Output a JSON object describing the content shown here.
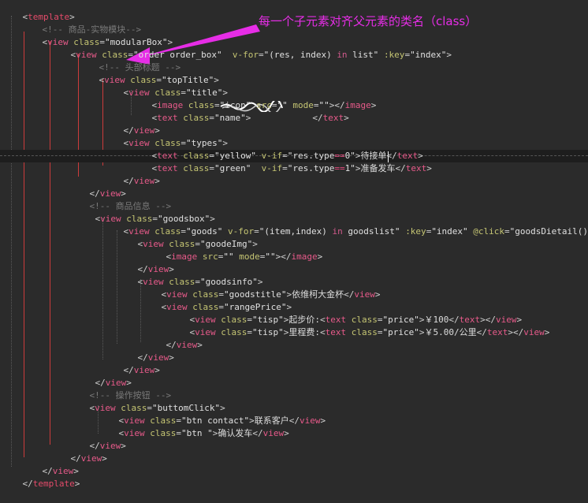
{
  "annotation": "每一个子元素对齐父元素的类名（class）",
  "code_lines": [
    "<template>",
    "<!-- 商品-实物模块-->",
    "<view class=\"modularBox\">",
    "<view class=\"order order_box\"  v-for=\"(res, index) in list\" :key=\"index\">",
    "<!-- 头部标题 -->",
    "<view class=\"topTitle\">",
    "<view class=\"title\">",
    "<image class=\"icon\" src=\"\" mode=\"\"></image>",
    "<text class=\"name\">",
    "</view>",
    "<view class=\"types\">",
    "<text class=\"yellow\" v-if=\"res.type==0\">待接单</text>",
    "<text class=\"green\"  v-if=\"res.type==1\">准备发车</text>",
    "</view>",
    "</view>",
    "<!-- 商品信息 -->",
    "<view class=\"goodsbox\">",
    "<view class=\"goods\" v-for=\"(item,index) in goodslist\" :key=\"index\" @click=\"goodsDietail()\">",
    "<view class=\"goodeImg\">",
    "<image src=\"\" mode=\"\"></image>",
    "</view>",
    "<view class=\"goodsinfo\">",
    "<view class=\"goodstitle\">依维柯大金杯</view>",
    "<view class=\"rangePrice\">",
    "<view class=\"tisp\">起步价:<text class=\"price\">￥100</text></view>",
    "<view class=\"tisp\">里程费:<text class=\"price\">￥5.00/公里</text></view>",
    "</view>",
    "</view>",
    "</view>",
    "</view>",
    "<!-- 操作按钮 -->",
    "<view class=\"buttomClick\">",
    "<view class=\"btn contact\">联系客户</view>",
    "<view class=\"btn \">确认发车</view>",
    "</view>",
    "</view>",
    "</view>",
    "</template>"
  ],
  "colors": {
    "background": "#2b2b2b",
    "tag": "#e44b6a",
    "attribute": "#c5c573",
    "comment": "#7a7a7a",
    "annotation": "#e62de6",
    "guide": "#cc3b3b"
  }
}
